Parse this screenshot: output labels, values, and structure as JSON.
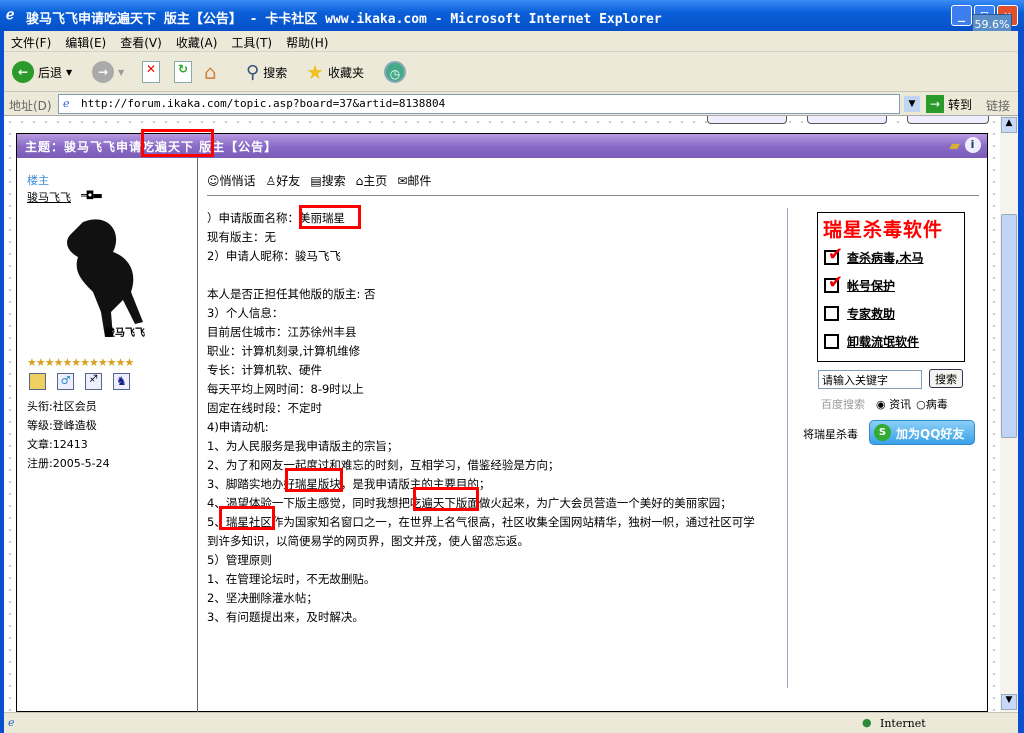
{
  "window": {
    "title": "骏马飞飞申请吃遍天下 版主【公告】 - 卡卡社区 www.ikaka.com - Microsoft Internet Explorer",
    "perf": "59.6%"
  },
  "menu": [
    "文件(F)",
    "编辑(E)",
    "查看(V)",
    "收藏(A)",
    "工具(T)",
    "帮助(H)"
  ],
  "toolbar": {
    "back": "后退",
    "search": "搜索",
    "favorites": "收藏夹"
  },
  "address": {
    "label": "地址(D)",
    "url": "http://forum.ikaka.com/topic.asp?board=37&artid=8138804",
    "go": "转到",
    "links": "链接"
  },
  "post": {
    "header": "主题：骏马飞飞申请吃遍天下 版主【公告】",
    "author": {
      "role": "楼主",
      "name": "骏马飞飞",
      "avatar_caption": "骏马飞飞",
      "stars": 12,
      "info": [
        "头衔:社区会员",
        "等级:登峰造极",
        "文章:12413",
        "注册:2005-5-24"
      ]
    },
    "actions": [
      "悄悄话",
      "好友",
      "搜索",
      "主页",
      "邮件"
    ],
    "lines": [
      "）申请版面名称：美丽瑞星",
      "现有版主：无",
      "2）申请人昵称：骏马飞飞",
      "",
      "本人是否正担任其他版的版主: 否",
      "3）个人信息：",
      "目前居住城市：江苏徐州丰县",
      "职业：计算机刻录,计算机维修",
      "专长：计算机软、硬件",
      "每天平均上网时间：8-9时以上",
      "固定在线时段：不定时",
      "4)申请动机:",
      "1、为人民服务是我申请版主的宗旨；",
      "2、为了和网友一起度过和难忘的时刻，互相学习，借鉴经验是方向；",
      "3、脚踏实地办好瑞星版块，是我申请版主的主要目的；",
      "4、渴望体验一下版主感觉，同时我想把吃遍天下版面做火起来，为广大会员营造一个美好的美丽家园；",
      "5、瑞星社区作为国家知名窗口之一，在世界上名气很高，社区收集全国网站精华，独树一帜，通过社区可学",
      "到许多知识，以简便易学的网页界，图文并茂，使人留恋忘返。",
      "5）管理原则",
      "1、在管理论坛时，不无故删贴。",
      "2、坚决删除灌水帖；",
      "3、有问题提出来，及时解决。"
    ]
  },
  "ad": {
    "title": "瑞星杀毒软件",
    "items": [
      {
        "label": "查杀病毒,木马",
        "checked": true
      },
      {
        "label": "帐号保护",
        "checked": true
      },
      {
        "label": "专家救助",
        "checked": false
      },
      {
        "label": "卸载流氓软件",
        "checked": false
      }
    ],
    "search_placeholder": "请输入关键字",
    "search_btn": "搜索",
    "baidu": "百度搜索",
    "radio1": "资讯",
    "radio2": "病毒",
    "qq_prefix": "将瑞星杀毒",
    "qq_btn": "加为QQ好友"
  },
  "status": {
    "zone": "Internet"
  }
}
